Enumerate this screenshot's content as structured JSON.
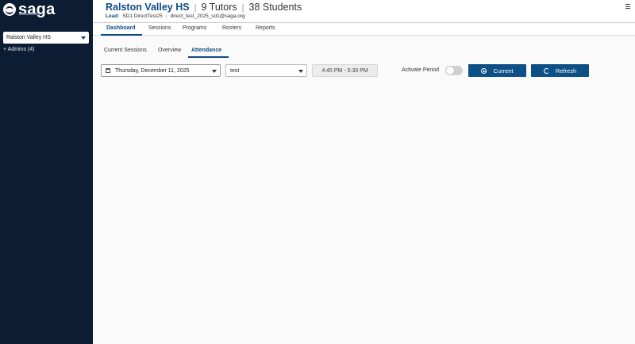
{
  "brand": {
    "name": "saga"
  },
  "sidebar": {
    "school_select": "Ralston Valley HS",
    "admins": "+ Admins (4)"
  },
  "header": {
    "school": "Ralston Valley HS",
    "tutors": "9 Tutors",
    "students": "38 Students",
    "separator": "|",
    "lead_label": "Lead:",
    "lead_name": "SD1 DirectTest25",
    "lead_email": "direct_test_2025_sd1@saga.org"
  },
  "nav": {
    "tabs": [
      "Dashboard",
      "Sessions",
      "Programs",
      "Rosters",
      "Reports"
    ],
    "active": "Dashboard"
  },
  "subtabs": {
    "items": [
      "Current Sessions",
      "Overview",
      "Attendance"
    ],
    "active": "Attendance"
  },
  "controls": {
    "date": "Thursday, December 11, 2025",
    "period": "test",
    "time_range": "4:45 PM - 5:30 PM",
    "activate_label": "Activate Period",
    "activate_on": false,
    "current_label": "Current",
    "refresh_label": "Refresh"
  },
  "colors": {
    "sidebar_bg": "#0b1c33",
    "accent": "#0d4c86",
    "button_bg": "#0d5086"
  }
}
